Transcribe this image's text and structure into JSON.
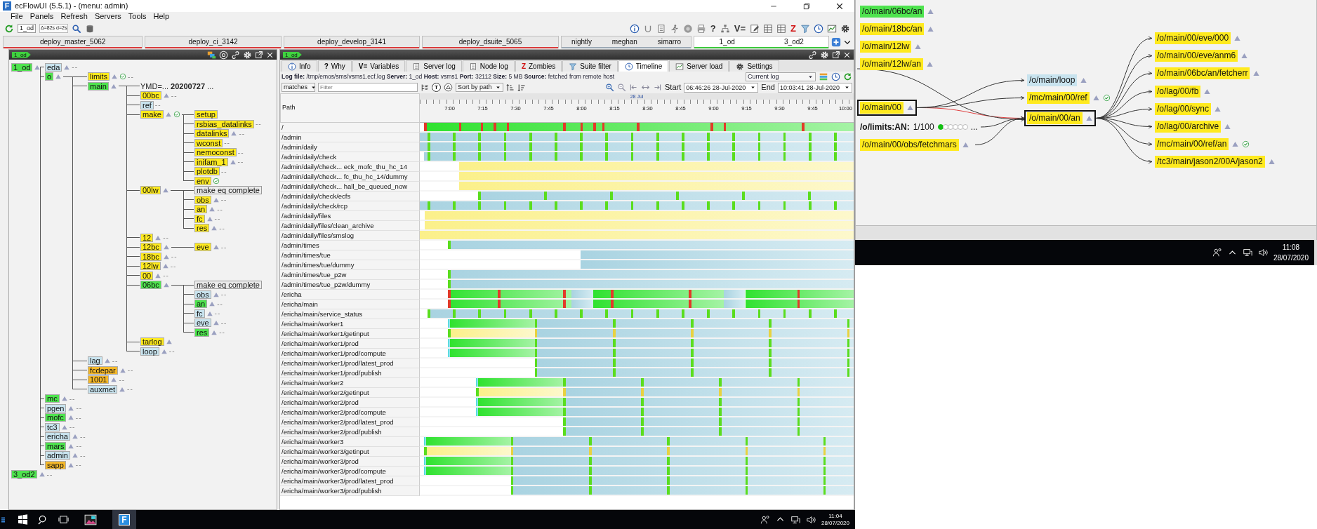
{
  "window": {
    "logo": "F",
    "title": "ecFlowUI (5.5.1) - (menu: admin)"
  },
  "menu": [
    "File",
    "Panels",
    "Refresh",
    "Servers",
    "Tools",
    "Help"
  ],
  "toolbar": {
    "server": "1_od",
    "timing": "Δ=82s d=2s",
    "right": [
      {
        "kind": "info"
      },
      {
        "kind": "curve"
      },
      {
        "kind": "doc"
      },
      {
        "kind": "figure"
      },
      {
        "kind": "disc"
      },
      {
        "kind": "printer"
      },
      {
        "kind": "glyph",
        "text": "?"
      },
      {
        "kind": "tree"
      },
      {
        "kind": "glyph",
        "text": "V="
      },
      {
        "kind": "pencil"
      },
      {
        "kind": "table"
      },
      {
        "kind": "table"
      },
      {
        "kind": "alert-glyph",
        "text": "Z"
      },
      {
        "kind": "filter"
      },
      {
        "kind": "clock"
      },
      {
        "kind": "chart"
      },
      {
        "kind": "gear"
      }
    ]
  },
  "server_tabs": [
    {
      "labels": [
        "deploy_master_5062"
      ],
      "color": "#d83a3a",
      "selected": false
    },
    {
      "labels": [
        "deploy_ci_3142"
      ],
      "color": "#d83a3a",
      "selected": false
    },
    {
      "labels": [
        "deploy_develop_3141"
      ],
      "color": "#d83a3a",
      "selected": false
    },
    {
      "labels": [
        "deploy_dsuite_5065"
      ],
      "color": "#d83a3a",
      "selected": false
    },
    {
      "labels": [
        "nightly",
        "meghan",
        "simarro"
      ],
      "color": "#9aa8b4",
      "selected": false
    },
    {
      "labels": [
        "1_od",
        "3_od2"
      ],
      "color": "#3cc83c",
      "selected": true
    }
  ],
  "left_pane": {
    "tag": "1_od",
    "tree": [
      {
        "label": "1_od",
        "color": "#4ee34e",
        "trigger": true,
        "children": [
          {
            "label": "eda",
            "color": "#c8e3ee",
            "trigger": true,
            "tail": "--"
          },
          {
            "label": "o",
            "color": "#4ee34e",
            "trigger": true,
            "children": [
              {
                "label": "limits",
                "color": "#ffea1e",
                "trigger": true,
                "check": true,
                "tail": "--"
              },
              {
                "label": "main",
                "color": "#4ee34e",
                "trigger": true,
                "children": [
                  {
                    "kind": "variable",
                    "label": "YMD=... **20200727** ..."
                  },
                  {
                    "label": "00bc",
                    "color": "#ffea1e",
                    "trigger": true,
                    "tail": "--"
                  },
                  {
                    "label": "ref",
                    "color": "#c8e3ee",
                    "tail": "--"
                  },
                  {
                    "label": "make",
                    "color": "#ffea1e",
                    "trigger": true,
                    "check": true,
                    "children": [
                      {
                        "label": "setup",
                        "color": "#ffea1e"
                      },
                      {
                        "label": "rsbias_datalinks",
                        "color": "#ffea1e",
                        "tail": "--"
                      },
                      {
                        "label": "datalinks",
                        "color": "#ffea1e",
                        "trigger": true,
                        "tail": "--"
                      },
                      {
                        "label": "wconst",
                        "color": "#ffea1e",
                        "tail": "--"
                      },
                      {
                        "label": "nemoconst",
                        "color": "#ffea1e",
                        "tail": "--"
                      },
                      {
                        "label": "inifam_1",
                        "color": "#ffea1e",
                        "trigger": true,
                        "tail": "--"
                      },
                      {
                        "label": "plotdb",
                        "color": "#ffea1e",
                        "tail": "--"
                      },
                      {
                        "label": "env",
                        "color": "#ffea1e",
                        "check": true
                      }
                    ]
                  },
                  {
                    "label": "00lw",
                    "color": "#ffea1e",
                    "trigger": true,
                    "children": [
                      {
                        "kind": "condition",
                        "label": "make eq complete"
                      },
                      {
                        "label": "obs",
                        "color": "#ffea1e",
                        "trigger": true,
                        "tail": "--"
                      },
                      {
                        "label": "an",
                        "color": "#ffea1e",
                        "trigger": true,
                        "tail": "--"
                      },
                      {
                        "label": "fc",
                        "color": "#ffea1e",
                        "trigger": true,
                        "tail": "--"
                      },
                      {
                        "label": "res",
                        "color": "#ffea1e",
                        "trigger": true,
                        "tail": "--"
                      }
                    ]
                  },
                  {
                    "label": "12",
                    "color": "#ffea1e",
                    "trigger": true,
                    "tail": "--"
                  },
                  {
                    "label": "12bc",
                    "color": "#ffea1e",
                    "trigger": true,
                    "children": [
                      {
                        "label": "eve",
                        "color": "#ffea1e",
                        "trigger": true,
                        "tail": "--"
                      }
                    ]
                  },
                  {
                    "label": "18bc",
                    "color": "#ffea1e",
                    "trigger": true,
                    "tail": "--"
                  },
                  {
                    "label": "12lw",
                    "color": "#ffea1e",
                    "trigger": true,
                    "tail": "--"
                  },
                  {
                    "label": "00",
                    "color": "#ffea1e",
                    "trigger": true,
                    "tail": "--"
                  },
                  {
                    "label": "06bc",
                    "color": "#4ee34e",
                    "trigger": true,
                    "children": [
                      {
                        "kind": "condition",
                        "label": "make eq complete"
                      },
                      {
                        "label": "obs",
                        "color": "#c8e3ee",
                        "trigger": true,
                        "tail": "--"
                      },
                      {
                        "label": "an",
                        "color": "#4ee34e",
                        "trigger": true,
                        "tail": "--"
                      },
                      {
                        "label": "fc",
                        "color": "#c8e3ee",
                        "trigger": true,
                        "tail": "--"
                      },
                      {
                        "label": "eve",
                        "color": "#c8e3ee",
                        "trigger": true,
                        "tail": "--"
                      },
                      {
                        "label": "res",
                        "color": "#4ee34e",
                        "trigger": true,
                        "tail": "--"
                      }
                    ]
                  },
                  {
                    "label": "tarlog",
                    "color": "#ffea1e",
                    "trigger": true
                  },
                  {
                    "label": "loop",
                    "color": "#c8e3ee",
                    "trigger": true,
                    "tail": "--"
                  }
                ]
              },
              {
                "label": "lag",
                "color": "#c8e3ee",
                "trigger": true,
                "tail": "--"
              },
              {
                "label": "fcdepar",
                "color": "#f4b82a",
                "trigger": true,
                "tail": "--"
              },
              {
                "label": "1001",
                "color": "#f4b82a",
                "trigger": true,
                "tail": "--"
              },
              {
                "label": "auxmet",
                "color": "#c8e3ee",
                "trigger": true,
                "tail": "--"
              }
            ]
          },
          {
            "label": "mc",
            "color": "#4ee34e",
            "trigger": true,
            "tail": "--"
          },
          {
            "label": "pgen",
            "color": "#c8e3ee",
            "trigger": true,
            "tail": "--"
          },
          {
            "label": "mofc",
            "color": "#4ee34e",
            "trigger": true,
            "tail": "--"
          },
          {
            "label": "tc3",
            "color": "#c8e3ee",
            "trigger": true,
            "tail": "--"
          },
          {
            "label": "ericha",
            "color": "#c8e3ee",
            "trigger": true,
            "tail": "--"
          },
          {
            "label": "mars",
            "color": "#4ee34e",
            "trigger": true,
            "tail": "--"
          },
          {
            "label": "admin",
            "color": "#c8e3ee",
            "trigger": true,
            "tail": "--"
          },
          {
            "label": "sapp",
            "color": "#f4b82a",
            "trigger": true,
            "tail": "--"
          }
        ]
      },
      {
        "label": "3_od2",
        "color": "#4ee34e",
        "trigger": true,
        "tail": "--"
      }
    ]
  },
  "right_pane": {
    "tag": "1_od",
    "tabs": [
      {
        "label": "Info",
        "selected": false
      },
      {
        "label": "Why",
        "glyph": "?",
        "selected": false
      },
      {
        "label": "Variables",
        "glyph": "V=",
        "selected": false
      },
      {
        "label": "Server log",
        "selected": false
      },
      {
        "label": "Node log",
        "selected": false
      },
      {
        "label": "Zombies",
        "glyph": "Z",
        "selected": false
      },
      {
        "label": "Suite filter",
        "selected": false
      },
      {
        "label": "Timeline",
        "selected": true
      },
      {
        "label": "Server load",
        "selected": false
      },
      {
        "label": "Settings",
        "selected": false
      }
    ],
    "log_info": "**Log file:** /tmp/emos/sms/vsms1.ecf.log **Server:** 1_od **Host:** vsms1 **Port:** 32112 **Size:** 5 MB **Source:** fetched from remote host",
    "log_select": "Current log",
    "filter_mode": "matches",
    "filter": {
      "placeholder": "Filter"
    },
    "text_button": "T",
    "sort": "Sort by path",
    "start_label": "Start",
    "start": "06:46:26 28-Jul-2020",
    "end_label": "End",
    "end": "10:03:41 28-Jul-2020",
    "timeline": {
      "path_header": "Path",
      "date": "28 Jul",
      "ticks": [
        "7:00",
        "7:15",
        "7:30",
        "7:45",
        "8:00",
        "8:15",
        "8:30",
        "8:45",
        "9:00",
        "9:15",
        "9:30",
        "9:45",
        "10:00"
      ],
      "rows": [
        {
          "path": "/",
          "kind": "active"
        },
        {
          "path": "/admin",
          "kind": "cycle"
        },
        {
          "path": "/admin/daily",
          "kind": "cycle"
        },
        {
          "path": "/admin/daily/check",
          "kind": "cycle"
        },
        {
          "path": "/admin/daily/check... eck_mofc_thu_hc_14",
          "kind": "complete"
        },
        {
          "path": "/admin/daily/check... fc_thu_hc_14/dummy",
          "kind": "complete"
        },
        {
          "path": "/admin/daily/check... hall_be_queued_now",
          "kind": "complete"
        },
        {
          "path": "/admin/daily/check/ecfs",
          "kind": "hourly"
        },
        {
          "path": "/admin/daily/check/rcp",
          "kind": "cycle"
        },
        {
          "path": "/admin/daily/files",
          "kind": "complete"
        },
        {
          "path": "/admin/daily/files/clean_archive",
          "kind": "complete"
        },
        {
          "path": "/admin/daily/files/smslog",
          "kind": "complete"
        },
        {
          "path": "/admin/times",
          "kind": "queued"
        },
        {
          "path": "/admin/times/tue",
          "kind": "waiting"
        },
        {
          "path": "/admin/times/tue/dummy",
          "kind": "waiting"
        },
        {
          "path": "/admin/times/tue_p2w",
          "kind": "queued"
        },
        {
          "path": "/admin/times/tue_p2w/dummy",
          "kind": "queued"
        },
        {
          "path": "/ericha",
          "kind": "burst"
        },
        {
          "path": "/ericha/main",
          "kind": "burst"
        },
        {
          "path": "/ericha/main/service_status",
          "kind": "cycle"
        },
        {
          "path": "/ericha/main/worker1",
          "kind": "worker"
        },
        {
          "path": "/ericha/main/worker1/getinput",
          "kind": "worker-wait"
        },
        {
          "path": "/ericha/main/worker1/prod",
          "kind": "worker"
        },
        {
          "path": "/ericha/main/worker1/prod/compute",
          "kind": "worker"
        },
        {
          "path": "/ericha/main/worker1/prod/latest_prod",
          "kind": "worker-late"
        },
        {
          "path": "/ericha/main/worker1/prod/publish",
          "kind": "worker-late"
        },
        {
          "path": "/ericha/main/worker2",
          "kind": "worker"
        },
        {
          "path": "/ericha/main/worker2/getinput",
          "kind": "worker-wait"
        },
        {
          "path": "/ericha/main/worker2/prod",
          "kind": "worker"
        },
        {
          "path": "/ericha/main/worker2/prod/compute",
          "kind": "worker"
        },
        {
          "path": "/ericha/main/worker2/prod/latest_prod",
          "kind": "worker-late"
        },
        {
          "path": "/ericha/main/worker2/prod/publish",
          "kind": "worker-late"
        },
        {
          "path": "/ericha/main/worker3",
          "kind": "worker"
        },
        {
          "path": "/ericha/main/worker3/getinput",
          "kind": "worker-wait"
        },
        {
          "path": "/ericha/main/worker3/prod",
          "kind": "worker"
        },
        {
          "path": "/ericha/main/worker3/prod/compute",
          "kind": "worker"
        },
        {
          "path": "/ericha/main/worker3/prod/latest_prod",
          "kind": "worker-late"
        },
        {
          "path": "/ericha/main/worker3/prod/publish",
          "kind": "worker-late"
        }
      ]
    }
  },
  "taskbar": {
    "apps": [
      {
        "kind": "image",
        "selected": false
      },
      {
        "kind": "logo",
        "text": "F",
        "selected": true
      }
    ],
    "time": "11:04",
    "date": "28/07/2020"
  },
  "graph_window": {
    "far_inputs": [
      {
        "label": "/o/main/06bc/an",
        "color": "#4ee34e"
      },
      {
        "label": "/o/main/18bc/an",
        "color": "#ffea1e"
      },
      {
        "label": "/o/main/12lw",
        "color": "#ffea1e"
      },
      {
        "label": "/o/main/12lw/an",
        "color": "#ffea1e"
      }
    ],
    "inputs": [
      {
        "kind": "node",
        "label": "/o/main/00",
        "color": "#ffea1e",
        "selected": true
      },
      {
        "kind": "limit",
        "label": "/o/limits:AN:",
        "value": "1/100",
        "dots": [
          true,
          false,
          false,
          false,
          false,
          false
        ],
        "more": "..."
      },
      {
        "kind": "node",
        "label": "/o/main/00/obs/fetchmars",
        "color": "#ffea1e",
        "selected": false
      }
    ],
    "siblings": [
      {
        "label": "/o/main/loop",
        "color": "#c8e3ee",
        "check": false
      },
      {
        "label": "/mc/main/00/ref",
        "color": "#ffea1e",
        "check": true
      }
    ],
    "focus": {
      "label": "/o/main/00/an",
      "color": "#ffea1e",
      "selected": true
    },
    "outputs": [
      {
        "label": "/o/main/00/eve/000",
        "color": "#ffea1e",
        "check": false
      },
      {
        "label": "/o/main/00/eve/anm6",
        "color": "#ffea1e",
        "check": false
      },
      {
        "label": "/o/main/06bc/an/fetcherr",
        "color": "#ffea1e",
        "check": false
      },
      {
        "label": "/o/lag/00/fb",
        "color": "#ffea1e",
        "check": false
      },
      {
        "label": "/o/lag/00/sync",
        "color": "#ffea1e",
        "check": false
      },
      {
        "label": "/o/lag/00/archive",
        "color": "#ffea1e",
        "check": false
      },
      {
        "label": "/mc/main/00/ref/an",
        "color": "#ffea1e",
        "check": true
      },
      {
        "label": "/tc3/main/jason2/00A/jason2",
        "color": "#ffea1e",
        "check": false
      }
    ],
    "taskbar": {
      "time": "11:08",
      "date": "28/07/2020"
    }
  }
}
